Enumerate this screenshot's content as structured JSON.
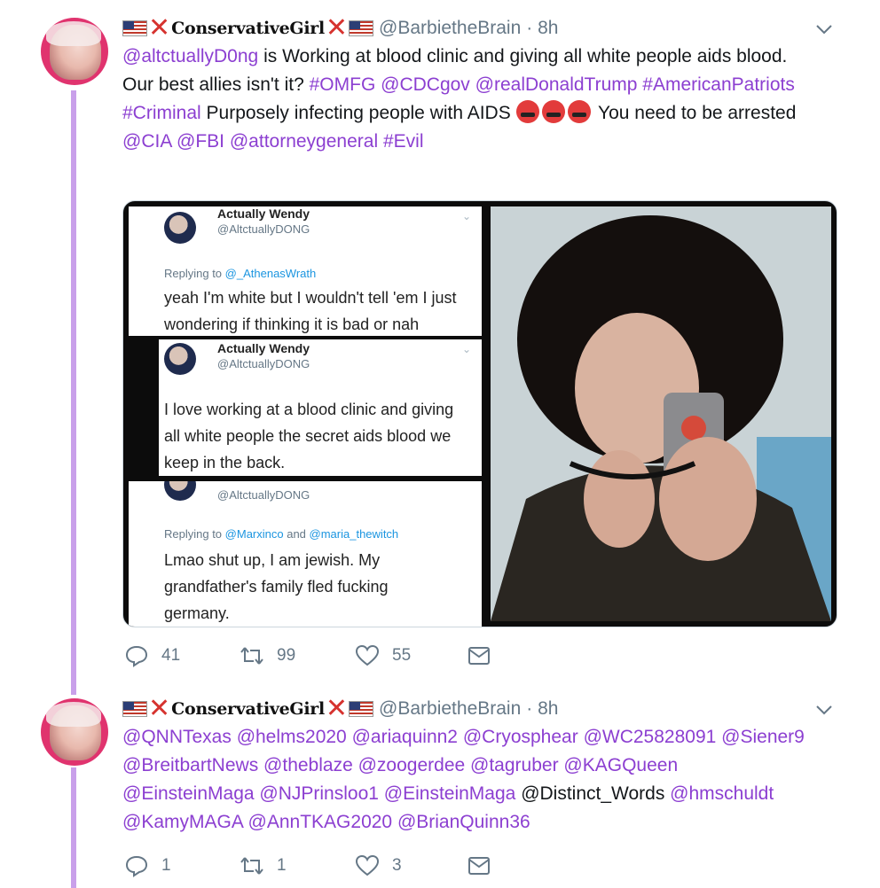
{
  "tweets": [
    {
      "display_name": "ConservativeGirl",
      "handle": "@BarbietheBrain",
      "time": "· 8h",
      "text": {
        "l1_mention": "@altctuallyD0ng",
        "l1_rest": " is Working at blood clinic and giving all white people aids blood.",
        "l2_pre": "Our best allies isn't it? ",
        "l2_tag1": "#OMFG",
        "l2_m1": "@CDCgov",
        "l2_m2": "@realDonaldTrump",
        "l2_tag2": "#AmericanPatriots",
        "l2_tag3": "#Criminal",
        "l2_mid": " Purposely infecting people with AIDS ",
        "l2_post": " You need to be arrested ",
        "l2_m3": "@CIA",
        "l2_m4": "@FBI",
        "l2_m5": "@attorneygeneral",
        "l2_tag4": "#Evil"
      },
      "replies": "41",
      "retweets": "99",
      "likes": "55"
    },
    {
      "display_name": "ConservativeGirl",
      "handle": "@BarbietheBrain",
      "time": "· 8h",
      "mentions": {
        "m1": "@QNNTexas",
        "m2": "@helms2020",
        "m3": "@ariaquinn2",
        "m4": "@Cryosphear",
        "m5": "@WC25828091",
        "m6": "@Siener9",
        "m7": "@BreitbartNews",
        "m8": "@theblaze",
        "m9": "@zoogerdee",
        "m10": "@tagruber",
        "m11": "@KAGQueen",
        "m12": "@EinsteinMaga",
        "m13": "@NJPrinsloo1",
        "m14": "@EinsteinMaga",
        "m15": "@Distinct_Words",
        "m16": "@hmschuldt",
        "m17": "@KamyMAGA",
        "m18": "@AnnTKAG2020",
        "m19": "@BrianQuinn36"
      },
      "replies": "1",
      "retweets": "1",
      "likes": "3"
    }
  ],
  "embedded": {
    "name": "Actually Wendy",
    "handle": "@AltctuallyDONG",
    "replying": "Replying to",
    "reply1_to": "@_AthenasWrath",
    "body1": "yeah I'm white but I wouldn't tell 'em I just wondering if thinking it is bad or nah",
    "body2": "I love working at a blood clinic and giving all white people the secret aids blood we keep in the back.",
    "reply3_to_a": "@Marxinco",
    "reply3_and": " and ",
    "reply3_to_b": "@maria_thewitch",
    "body3": "Lmao shut up, I am jewish. My grandfather's family fled fucking germany."
  },
  "icons": [
    "flag-icon",
    "x-mark-icon",
    "chevron-down-icon",
    "reply-icon",
    "retweet-icon",
    "like-icon",
    "message-icon",
    "angry-face-icon"
  ],
  "colors": {
    "link": "#8c3fd1",
    "thread": "#c9a0ea",
    "muted": "#657786",
    "avatar": "#e0336e"
  }
}
